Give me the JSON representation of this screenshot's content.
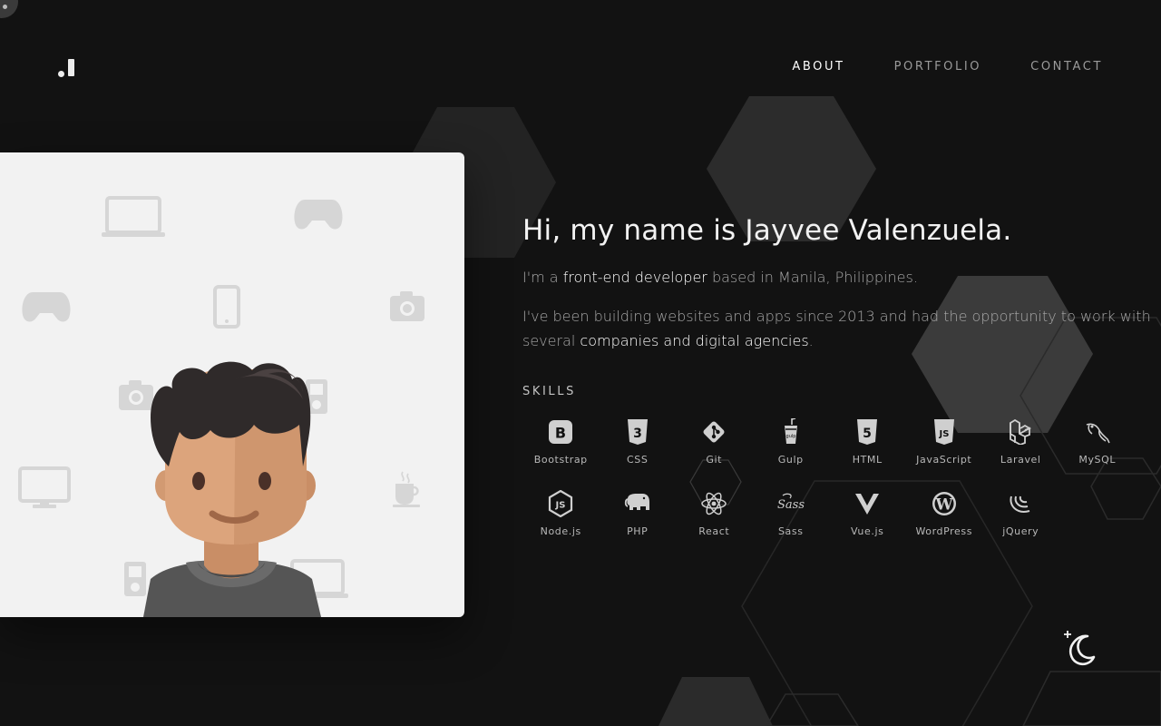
{
  "logo": {
    "icon": "brand-logo-icon"
  },
  "nav": {
    "items": [
      {
        "label": "ABOUT",
        "active": true
      },
      {
        "label": "PORTFOLIO",
        "active": false
      },
      {
        "label": "CONTACT",
        "active": false
      }
    ]
  },
  "hero": {
    "heading": "Hi, my name is Jayvee Valenzuela.",
    "p1_prefix": "I'm a ",
    "p1_highlight": "front-end developer",
    "p1_suffix": " based in Manila, Philippines.",
    "p2_prefix": "I've been building websites and apps since 2013 and had the opportunity to work with several ",
    "p2_highlight": "companies and digital agencies",
    "p2_suffix": "."
  },
  "skills": {
    "title": "SKILLS",
    "items": [
      {
        "label": "Bootstrap",
        "icon": "bootstrap-icon"
      },
      {
        "label": "CSS",
        "icon": "css3-icon"
      },
      {
        "label": "Git",
        "icon": "git-icon"
      },
      {
        "label": "Gulp",
        "icon": "gulp-icon"
      },
      {
        "label": "HTML",
        "icon": "html5-icon"
      },
      {
        "label": "JavaScript",
        "icon": "javascript-icon"
      },
      {
        "label": "Laravel",
        "icon": "laravel-icon"
      },
      {
        "label": "MySQL",
        "icon": "mysql-icon"
      },
      {
        "label": "Node.js",
        "icon": "nodejs-icon"
      },
      {
        "label": "PHP",
        "icon": "php-icon"
      },
      {
        "label": "React",
        "icon": "react-icon"
      },
      {
        "label": "Sass",
        "icon": "sass-icon"
      },
      {
        "label": "Vue.js",
        "icon": "vuejs-icon"
      },
      {
        "label": "WordPress",
        "icon": "wordpress-icon"
      },
      {
        "label": "jQuery",
        "icon": "jquery-icon"
      }
    ]
  },
  "theme_toggle": {
    "icon": "moon-icon"
  },
  "colors": {
    "background": "#121212",
    "accent": "#ffffff",
    "muted": "#9a9a9a",
    "card": "#f2f2f2"
  }
}
